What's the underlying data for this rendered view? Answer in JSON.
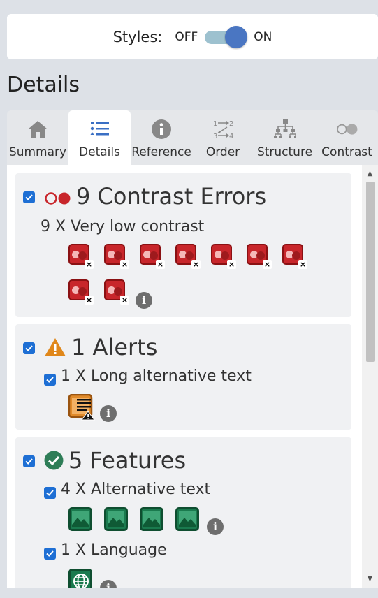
{
  "styles": {
    "label": "Styles:",
    "off": "OFF",
    "on": "ON",
    "enabled": true
  },
  "page_title": "Details",
  "tabs": [
    {
      "label": "Summary",
      "icon": "home-icon"
    },
    {
      "label": "Details",
      "icon": "list-icon",
      "active": true
    },
    {
      "label": "Reference",
      "icon": "info-icon"
    },
    {
      "label": "Order",
      "icon": "order-icon"
    },
    {
      "label": "Structure",
      "icon": "structure-icon"
    },
    {
      "label": "Contrast",
      "icon": "contrast-icon"
    }
  ],
  "errors": {
    "title": "9 Contrast Errors",
    "checked": true,
    "items": [
      {
        "label": "9 X Very low contrast",
        "count": 9
      }
    ]
  },
  "alerts": {
    "title": "1 Alerts",
    "checked": true,
    "items": [
      {
        "label": "1 X Long alternative text",
        "count": 1,
        "checked": true
      }
    ]
  },
  "features": {
    "title": "5 Features",
    "checked": true,
    "items": [
      {
        "label": "4 X Alternative text",
        "count": 4,
        "checked": true
      },
      {
        "label": "1 X Language",
        "count": 1,
        "checked": true
      }
    ]
  },
  "colors": {
    "accent": "#4a76c2",
    "error": "#c8262b",
    "alert": "#e0871a",
    "feature": "#1a7a4e",
    "checkbox": "#1e6fd4"
  }
}
